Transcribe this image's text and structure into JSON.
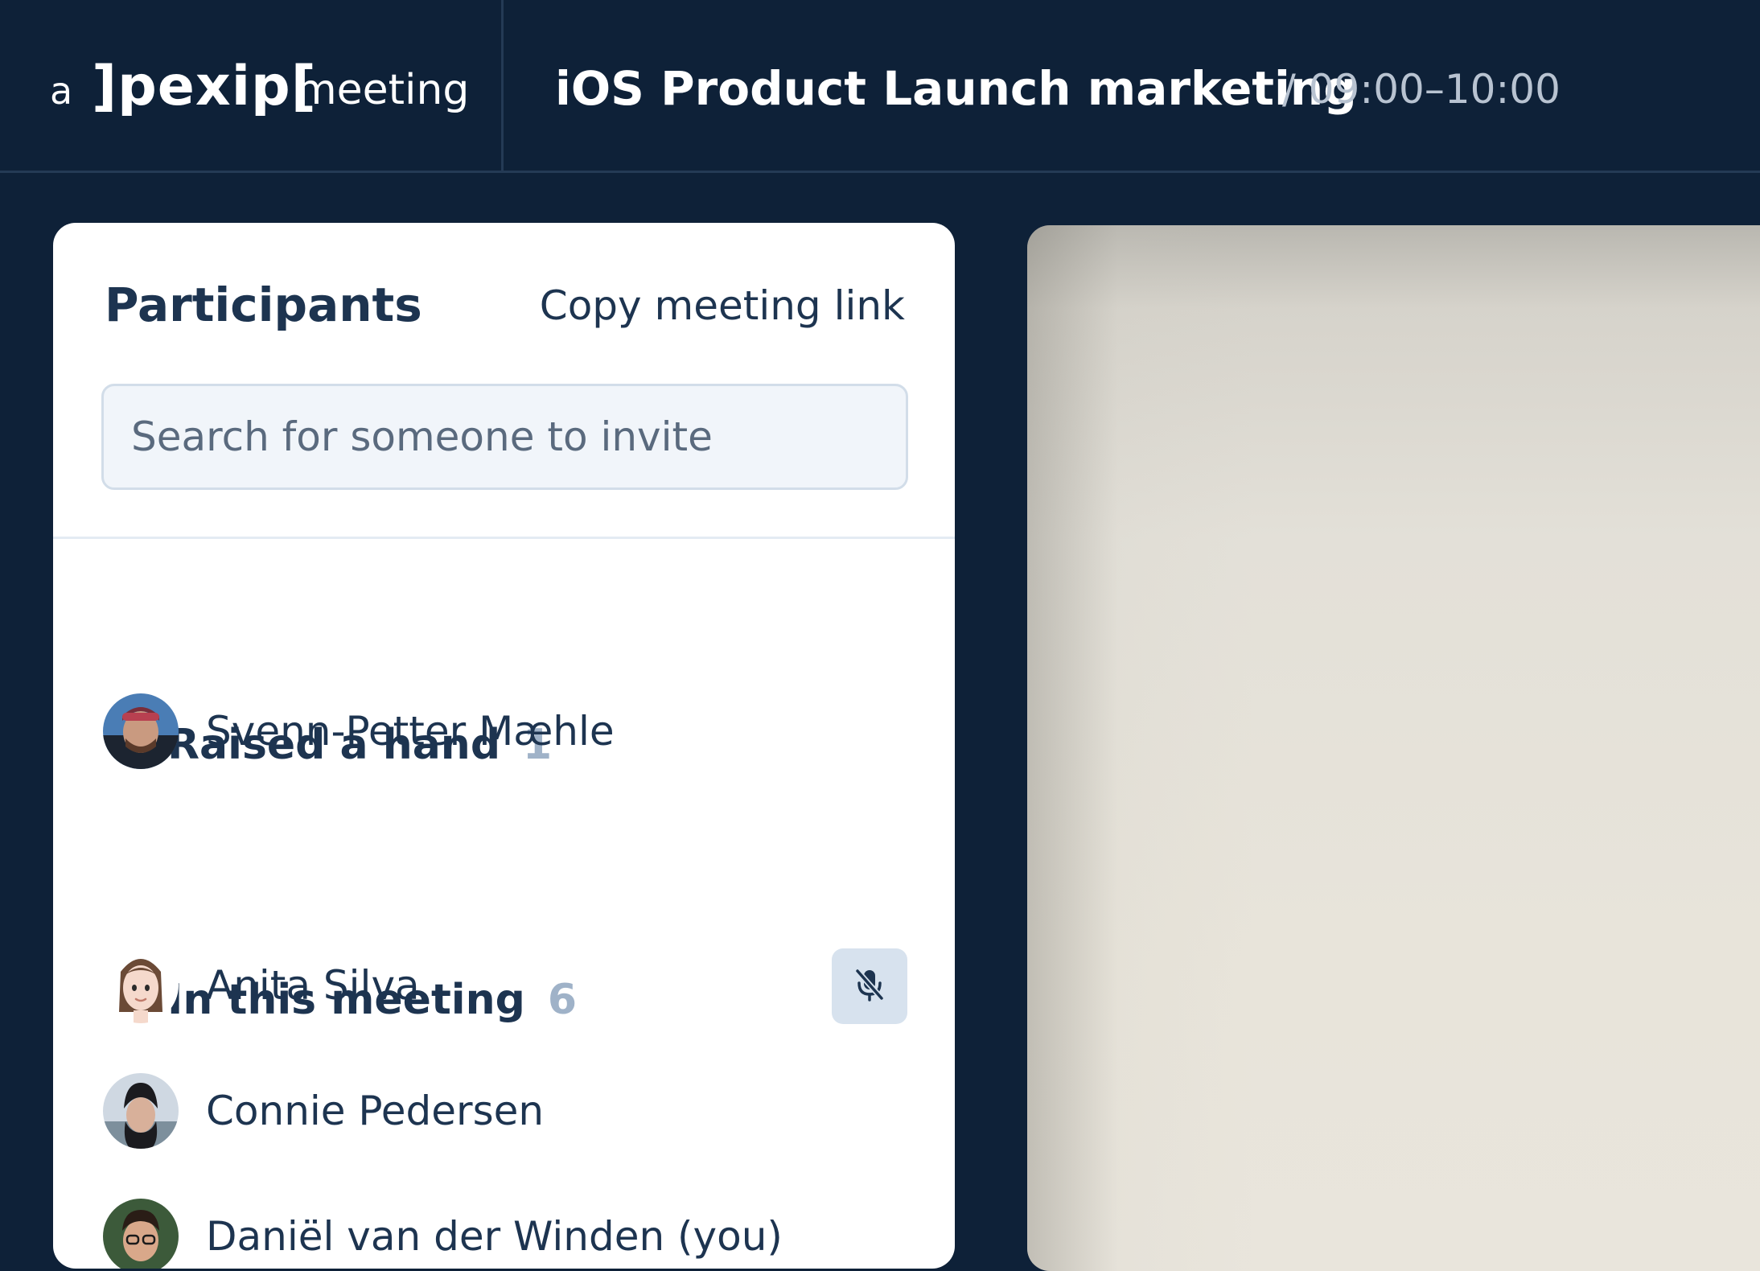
{
  "header": {
    "brand_prefix": "a",
    "brand_logo": "]pexip[",
    "brand_suffix": "meeting",
    "meeting_title": "iOS Product Launch marketing",
    "meeting_time": "/ 09:00–10:00"
  },
  "participants_panel": {
    "title": "Participants",
    "copy_link_label": "Copy meeting link",
    "search_placeholder": "Search for someone to invite",
    "sections": [
      {
        "label": "Raised a hand",
        "count": "1",
        "icon": "chevron-down-icon",
        "people": [
          {
            "name": "Svenn-Petter Mæhle",
            "avatar": "avatar-photo"
          }
        ]
      },
      {
        "label": "In this meeting",
        "count": "6",
        "icon": "chevron-down-icon",
        "people": [
          {
            "name": "Anita Silva",
            "avatar": "avatar-memoji",
            "status_icon": "microphone-muted-icon"
          },
          {
            "name": "Connie Pedersen",
            "avatar": "avatar-photo"
          },
          {
            "name": "Daniël van der Winden (you)",
            "avatar": "avatar-photo"
          }
        ]
      }
    ]
  },
  "colors": {
    "background": "#0e2138",
    "panel": "#ffffff",
    "text_primary": "#1d3450",
    "count_muted": "#9fb2c8",
    "search_bg": "#f1f5fa",
    "mute_button_bg": "#d7e2ee"
  }
}
